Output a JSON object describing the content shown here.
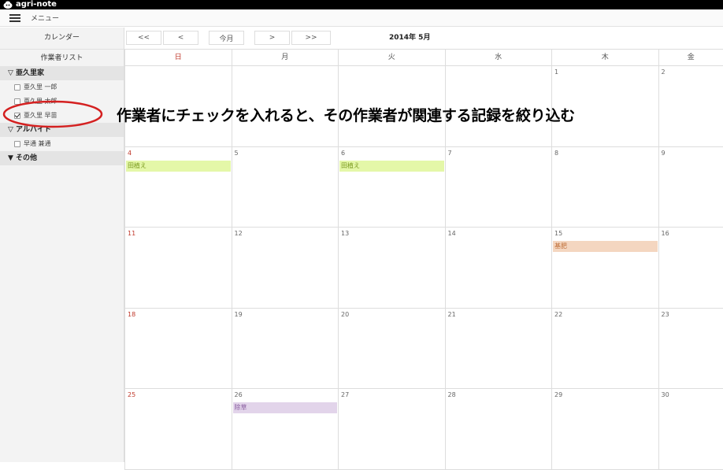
{
  "app": {
    "name": "agri-note"
  },
  "menubar": {
    "menu_label": "メニュー"
  },
  "sidebar": {
    "calendar_label": "カレンダー",
    "worker_list_label": "作業者リスト",
    "groups": [
      {
        "label": "▽ 亜久里家",
        "workers": [
          {
            "name": "亜久里 一郎",
            "checked": false
          },
          {
            "name": "亜久里 太郎",
            "checked": false
          },
          {
            "name": "亜久里 早苗",
            "checked": true
          }
        ]
      },
      {
        "label": "▽ アルバイト",
        "workers": [
          {
            "name": "早通 兼通",
            "checked": false
          }
        ]
      },
      {
        "label": "▼ その他",
        "workers": []
      }
    ]
  },
  "nav": {
    "prev_prev": "<<",
    "prev": "<",
    "today": "今月",
    "next": ">",
    "next_next": ">>",
    "month_title": "2014年 5月"
  },
  "calendar": {
    "weekdays": [
      "日",
      "月",
      "火",
      "水",
      "木",
      "金"
    ],
    "weeks": [
      [
        {
          "day": ""
        },
        {
          "day": ""
        },
        {
          "day": ""
        },
        {
          "day": ""
        },
        {
          "day": "1"
        },
        {
          "day": "2"
        }
      ],
      [
        {
          "day": "4",
          "event": "田植え",
          "color": "#e4f7a8",
          "text_color": "#7a9a1e"
        },
        {
          "day": "5"
        },
        {
          "day": "6",
          "event": "田植え",
          "color": "#e4f7a8",
          "text_color": "#7a9a1e"
        },
        {
          "day": "7"
        },
        {
          "day": "8"
        },
        {
          "day": "9"
        }
      ],
      [
        {
          "day": "11"
        },
        {
          "day": "12"
        },
        {
          "day": "13"
        },
        {
          "day": "14"
        },
        {
          "day": "15",
          "event": "基肥",
          "color": "#f4d6c0",
          "text_color": "#c0703a"
        },
        {
          "day": "16"
        }
      ],
      [
        {
          "day": "18"
        },
        {
          "day": "19"
        },
        {
          "day": "20"
        },
        {
          "day": "21"
        },
        {
          "day": "22"
        },
        {
          "day": "23"
        }
      ],
      [
        {
          "day": "25"
        },
        {
          "day": "26",
          "event": "除草",
          "color": "#e2d4ea",
          "text_color": "#8a5ea0"
        },
        {
          "day": "27"
        },
        {
          "day": "28"
        },
        {
          "day": "29"
        },
        {
          "day": "30"
        }
      ]
    ]
  },
  "annotation": {
    "text": "作業者にチェックを入れると、その作業者が関連する記録を絞り込む"
  },
  "colors": {
    "titlebar": "#000000",
    "sunday": "#c0392b",
    "highlight_ellipse": "#d42020"
  }
}
